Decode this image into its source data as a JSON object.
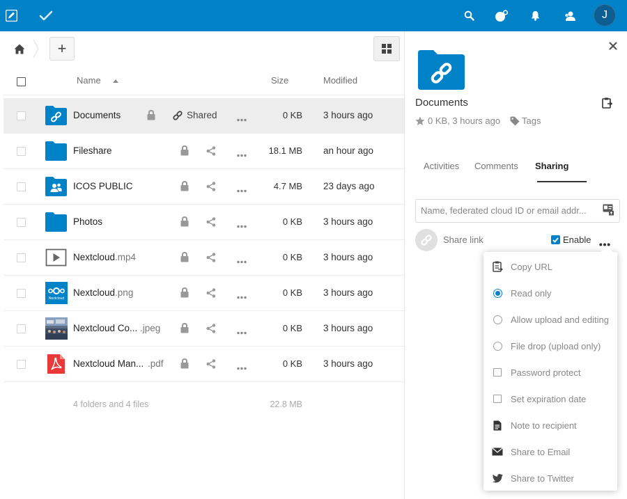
{
  "header": {
    "icons": [
      "files-app-icon",
      "tasks-app-icon",
      "search-icon",
      "contacts-menu-icon",
      "notifications-icon",
      "contacts-icon"
    ],
    "avatar_initial": "J",
    "accent": "#0082c9"
  },
  "controls": {
    "add_label": "+"
  },
  "table": {
    "col_name": "Name",
    "col_size": "Size",
    "col_modified": "Modified",
    "sort": "name-ascending"
  },
  "files": [
    {
      "name": "Documents",
      "ext": "",
      "type": "folder-link",
      "size": "0 KB",
      "modified": "3 hours ago",
      "shared_label": "Shared",
      "selected": true
    },
    {
      "name": "Fileshare",
      "ext": "",
      "type": "folder",
      "size": "18.1 MB",
      "modified": "an hour ago"
    },
    {
      "name": "ICOS PUBLIC",
      "ext": "",
      "type": "folder-group",
      "size": "4.7 MB",
      "modified": "23 days ago"
    },
    {
      "name": "Photos",
      "ext": "",
      "type": "folder",
      "size": "0 KB",
      "modified": "3 hours ago"
    },
    {
      "name": "Nextcloud",
      "ext": ".mp4",
      "type": "video",
      "size": "0 KB",
      "modified": "3 hours ago"
    },
    {
      "name": "Nextcloud",
      "ext": ".png",
      "type": "image-logo",
      "size": "0 KB",
      "modified": "3 hours ago"
    },
    {
      "name": "Nextcloud Co...",
      "ext": ".jpeg",
      "type": "image-photo",
      "size": "0 KB",
      "modified": "3 hours ago"
    },
    {
      "name": "Nextcloud Man...",
      "ext": ".pdf",
      "type": "pdf",
      "size": "0 KB",
      "modified": "3 hours ago"
    }
  ],
  "thumb_text": {
    "nextcloud_logo": "Nextcloud"
  },
  "summary": {
    "counts": "4 folders and 4 files",
    "total_size": "22.8 MB"
  },
  "sidebar": {
    "title": "Documents",
    "meta": "0 KB, 3 hours ago",
    "tags_label": "Tags",
    "tabs": [
      "Activities",
      "Comments",
      "Sharing"
    ],
    "active_tab": "Sharing",
    "share_input_placeholder": "Name, federated cloud ID or email addr...",
    "share_link_label": "Share link",
    "enable_label": "Enable",
    "enable_checked": true
  },
  "share_menu": [
    {
      "kind": "action",
      "icon": "clipboard-icon",
      "label": "Copy URL"
    },
    {
      "kind": "radio",
      "checked": true,
      "label": "Read only"
    },
    {
      "kind": "radio",
      "checked": false,
      "label": "Allow upload and editing"
    },
    {
      "kind": "radio",
      "checked": false,
      "label": "File drop (upload only)"
    },
    {
      "kind": "checkbox",
      "checked": false,
      "label": "Password protect"
    },
    {
      "kind": "checkbox",
      "checked": false,
      "label": "Set expiration date"
    },
    {
      "kind": "action",
      "icon": "note-icon",
      "label": "Note to recipient"
    },
    {
      "kind": "action",
      "icon": "mail-icon",
      "label": "Share to Email"
    },
    {
      "kind": "action",
      "icon": "twitter-icon",
      "label": "Share to Twitter"
    }
  ]
}
